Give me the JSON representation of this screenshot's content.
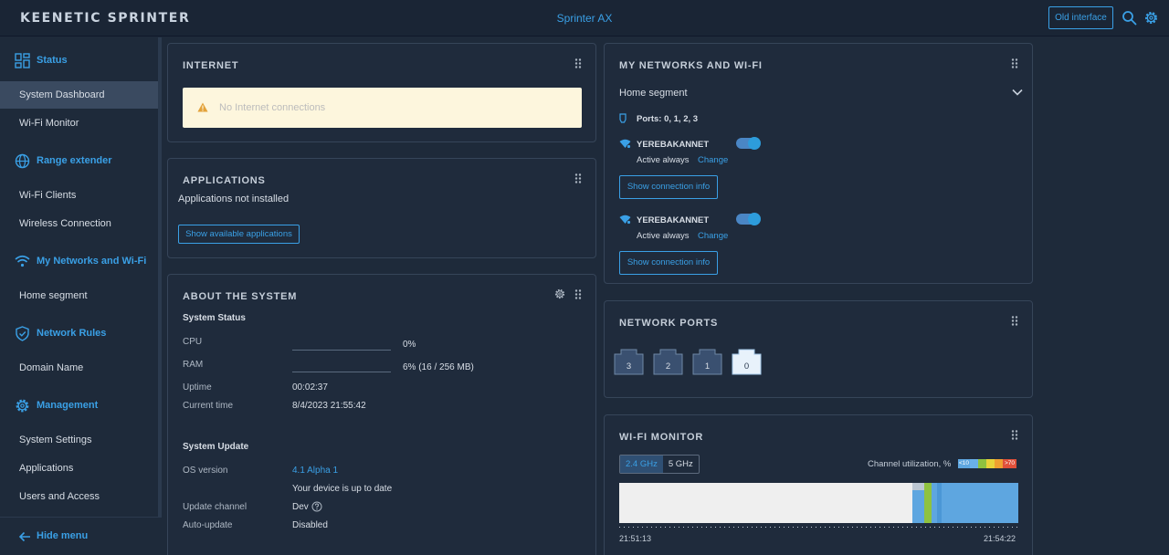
{
  "header": {
    "brand_a": "KEENETIC",
    "brand_b": "SPRINTER",
    "model": "Sprinter AX",
    "old_interface": "Old interface"
  },
  "sidebar": {
    "sections": [
      {
        "label": "Status",
        "items": [
          "System Dashboard",
          "Wi-Fi Monitor"
        ]
      },
      {
        "label": "Range extender",
        "items": [
          "Wi-Fi Clients",
          "Wireless Connection"
        ]
      },
      {
        "label": "My Networks and Wi-Fi",
        "items": [
          "Home segment"
        ]
      },
      {
        "label": "Network Rules",
        "items": [
          "Domain Name"
        ]
      },
      {
        "label": "Management",
        "items": [
          "System Settings",
          "Applications",
          "Users and Access"
        ]
      }
    ],
    "hide_menu": "Hide menu"
  },
  "internet": {
    "title": "INTERNET",
    "warning": "No Internet connections"
  },
  "applications": {
    "title": "APPLICATIONS",
    "status": "Applications not installed",
    "button": "Show available applications"
  },
  "about": {
    "title": "ABOUT THE SYSTEM",
    "status_heading": "System Status",
    "cpu_label": "CPU",
    "cpu_value": "0%",
    "ram_label": "RAM",
    "ram_value": "6% (16 / 256 MB)",
    "uptime_label": "Uptime",
    "uptime_value": "00:02:37",
    "time_label": "Current time",
    "time_value": "8/4/2023 21:55:42",
    "update_heading": "System Update",
    "os_label": "OS version",
    "os_value": "4.1 Alpha 1",
    "os_note": "Your device is up to date",
    "channel_label": "Update channel",
    "channel_value": "Dev",
    "auto_label": "Auto-update",
    "auto_value": "Disabled"
  },
  "networks": {
    "title": "MY NETWORKS AND WI-FI",
    "segment": "Home segment",
    "ports": "Ports: 0, 1, 2, 3",
    "wifi": [
      {
        "ssid": "YEREBAKANNET",
        "schedule": "Active always",
        "change": "Change",
        "button": "Show connection info",
        "enabled": true
      },
      {
        "ssid": "YEREBAKANNET",
        "schedule": "Active always",
        "change": "Change",
        "button": "Show connection info",
        "enabled": true
      }
    ]
  },
  "network_ports": {
    "title": "NETWORK PORTS",
    "ports": [
      {
        "label": "3",
        "connected": false
      },
      {
        "label": "2",
        "connected": false
      },
      {
        "label": "1",
        "connected": false
      },
      {
        "label": "0",
        "connected": true
      }
    ]
  },
  "wifi_monitor": {
    "title": "WI-FI MONITOR",
    "tabs": [
      "2.4 GHz",
      "5 GHz"
    ],
    "active_tab": "2.4 GHz",
    "utilization_label": "Channel utilization, %",
    "legend_low": "<10",
    "legend_high": ">70",
    "time_start": "21:51:13",
    "time_end": "21:54:22",
    "colors": {
      "idle": "#efefef",
      "low": "#5ea6e0",
      "mid": "#8fc23f",
      "gray": "#bcc7d3"
    }
  }
}
